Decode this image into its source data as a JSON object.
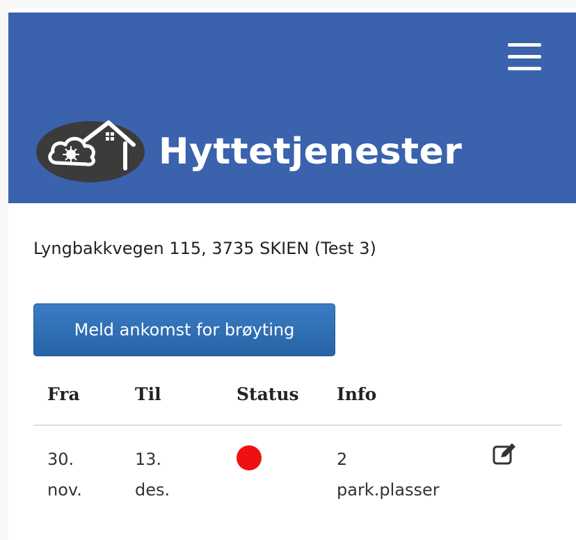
{
  "brand": {
    "name": "Hyttetjenester",
    "logo_icon": "cloud-house-logo-icon"
  },
  "navbar": {
    "background": "#3a62ad",
    "menu_icon": "hamburger-menu-icon"
  },
  "address": "Lyngbakkvegen 115, 3735 SKIEN (Test 3)",
  "primary_button": {
    "label": "Meld ankomst for brøyting",
    "color": "#2f6fb4"
  },
  "table": {
    "headers": [
      "Fra",
      "Til",
      "Status",
      "Info"
    ],
    "rows": [
      {
        "fra": [
          "30.",
          "nov."
        ],
        "til": [
          "13.",
          "des."
        ],
        "status_color": "#ee1111",
        "info": [
          "2",
          "park.plasser"
        ],
        "action_icon": "edit-icon"
      }
    ]
  }
}
